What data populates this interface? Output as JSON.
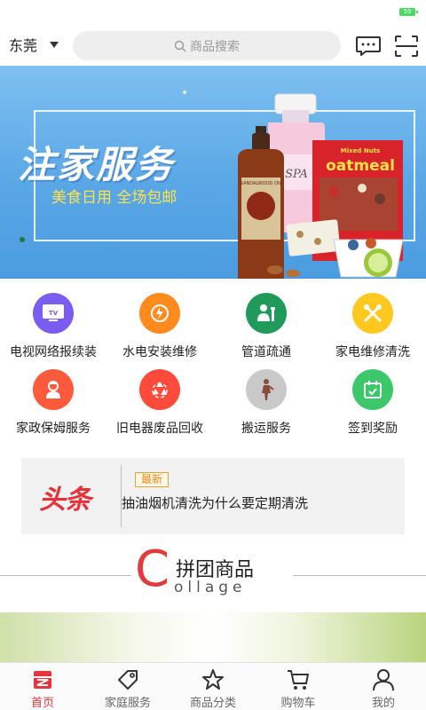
{
  "status_bar": {
    "battery": "59"
  },
  "header": {
    "city": "东莞",
    "search_placeholder": "商品搜索"
  },
  "banner": {
    "title": "注家服务",
    "subtitle": "美食日用 全场包邮",
    "product_labels": [
      "SANDALWOOD OIL",
      "SPA",
      "oatmeal",
      "Mixed Nuts"
    ]
  },
  "services": [
    {
      "label": "电视网络报续装",
      "color": "#7a5cf0",
      "icon": "tv-icon"
    },
    {
      "label": "水电安装维修",
      "color": "#ff8a1e",
      "icon": "water-drop-icon"
    },
    {
      "label": "管道疏通",
      "color": "#1f9a5a",
      "icon": "plumber-icon"
    },
    {
      "label": "家电维修清洗",
      "color": "#ffc81e",
      "icon": "tools-icon"
    },
    {
      "label": "家政保姆服务",
      "color": "#ff5a3c",
      "icon": "housekeeper-icon"
    },
    {
      "label": "旧电器废品回收",
      "color": "#ff4a3c",
      "icon": "recycle-icon"
    },
    {
      "label": "搬运服务",
      "color": "#c9c9c9",
      "icon": "mover-icon"
    },
    {
      "label": "签到奖励",
      "color": "#3cc86a",
      "icon": "calendar-check-icon"
    }
  ],
  "news": {
    "logo": "头条",
    "tag": "最新",
    "text": "抽油烟机清洗为什么要定期清洗"
  },
  "section": {
    "letter": "C",
    "title": "拼团商品",
    "subtitle": "ollage"
  },
  "tabbar": [
    {
      "label": "首页",
      "icon": "home-icon",
      "active": true
    },
    {
      "label": "家庭服务",
      "icon": "tag-icon",
      "active": false
    },
    {
      "label": "商品分类",
      "icon": "star-icon",
      "active": false
    },
    {
      "label": "购物车",
      "icon": "cart-icon",
      "active": false
    },
    {
      "label": "我的",
      "icon": "user-icon",
      "active": false
    }
  ],
  "colors": {
    "accent": "#e8343e",
    "banner_blue": "#5aa7e6",
    "news_tag": "#f08a14"
  }
}
